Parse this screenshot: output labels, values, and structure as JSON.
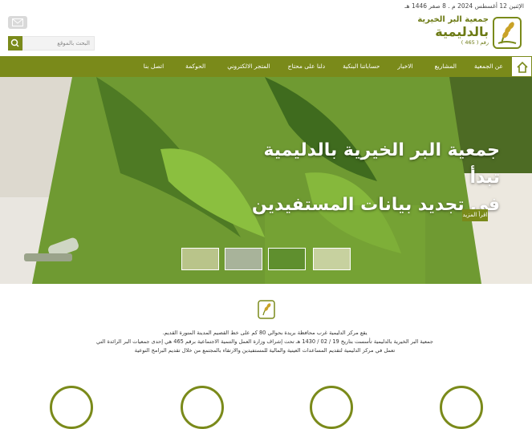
{
  "header": {
    "date": "الإثنين 12 أغسطس 2024 م . 8 صفر 1446 هـ",
    "logo": {
      "line1": "جمعية البر الخيرية",
      "line2": "بالدليمية",
      "registration": "رقم ( 465 )"
    },
    "search": {
      "placeholder": "البحث بالموقع"
    }
  },
  "nav": {
    "items": [
      "عن الجمعية",
      "المشاريع",
      "الاخبار",
      "حساباتنا البنكية",
      "دلنا على محتاج",
      "المتجر الالكتروني",
      "الحوكمة",
      "اتصل بنا"
    ]
  },
  "hero": {
    "title_line1": "جمعية البر الخيرية بالدليمية تبدأ",
    "title_line2": "في تجديد بيانات المستفيدين",
    "more_label": "اقرأ المزيد"
  },
  "about": {
    "line1": "يقع مركز الدليمية غرب محافظة بريدة بحوالي 80 كم على خط القصيم المدينة المنورة القديم.",
    "line2": "جمعية البر الخيرية بالدليمية تأسست بتاريخ 19 / 02 / 1430 هـ تحت إشراف وزارة العمل والتنمية الاجتماعية برقم 465 هي إحدى جمعيات البر الرائدة التي",
    "line3": "تعمل في مركز الدليمية لتقديم المساعدات العينية والمالية للمستفيدين والارتقاء بالمجتمع من خلال تقديم البرامج النوعية"
  },
  "colors": {
    "primary": "#7a8a1a",
    "hero_green": "#5b7a2a"
  },
  "icons": [
    "wheat-emblem-icon",
    "email-icon",
    "search-icon",
    "home-icon"
  ]
}
